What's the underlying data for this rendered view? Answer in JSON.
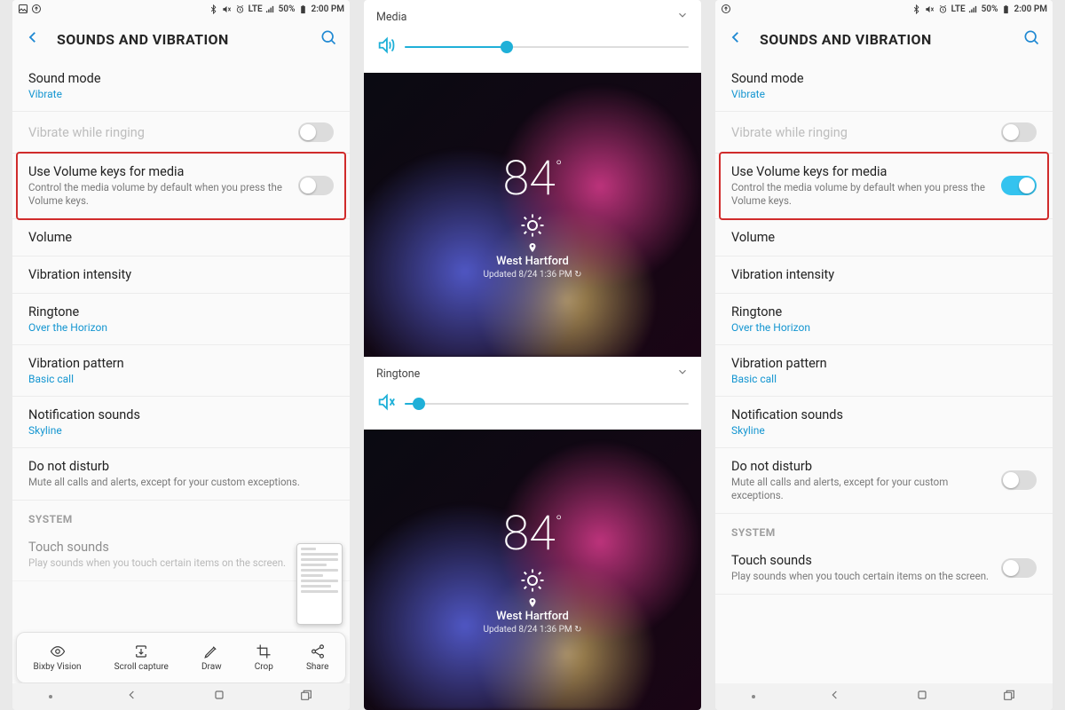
{
  "status": {
    "battery_pct": "50%",
    "time": "2:00 PM",
    "lte": "LTE"
  },
  "settings": {
    "title": "SOUNDS AND VIBRATION",
    "sound_mode_label": "Sound mode",
    "sound_mode_value": "Vibrate",
    "vibrate_ringing": "Vibrate while ringing",
    "vol_keys_label": "Use Volume keys for media",
    "vol_keys_desc": "Control the media volume by default when you press the Volume keys.",
    "volume": "Volume",
    "vib_intensity": "Vibration intensity",
    "ringtone_label": "Ringtone",
    "ringtone_value": "Over the Horizon",
    "vib_pattern_label": "Vibration pattern",
    "vib_pattern_value": "Basic call",
    "notif_label": "Notification sounds",
    "notif_value": "Skyline",
    "dnd_label": "Do not disturb",
    "dnd_desc": "Mute all calls and alerts, except for your custom exceptions.",
    "system_hdr": "SYSTEM",
    "touch_label": "Touch sounds",
    "touch_desc": "Play sounds when you touch certain items on the screen."
  },
  "ss_tools": {
    "bixby": "Bixby Vision",
    "scroll": "Scroll capture",
    "draw": "Draw",
    "crop": "Crop",
    "share": "Share"
  },
  "volpanel": {
    "media": "Media",
    "ringtone": "Ringtone",
    "media_pct": 0.36,
    "ring_pct": 0.05
  },
  "weather": {
    "temp": "84",
    "city": "West Hartford",
    "updated": "Updated 8/24 1:36 PM"
  }
}
